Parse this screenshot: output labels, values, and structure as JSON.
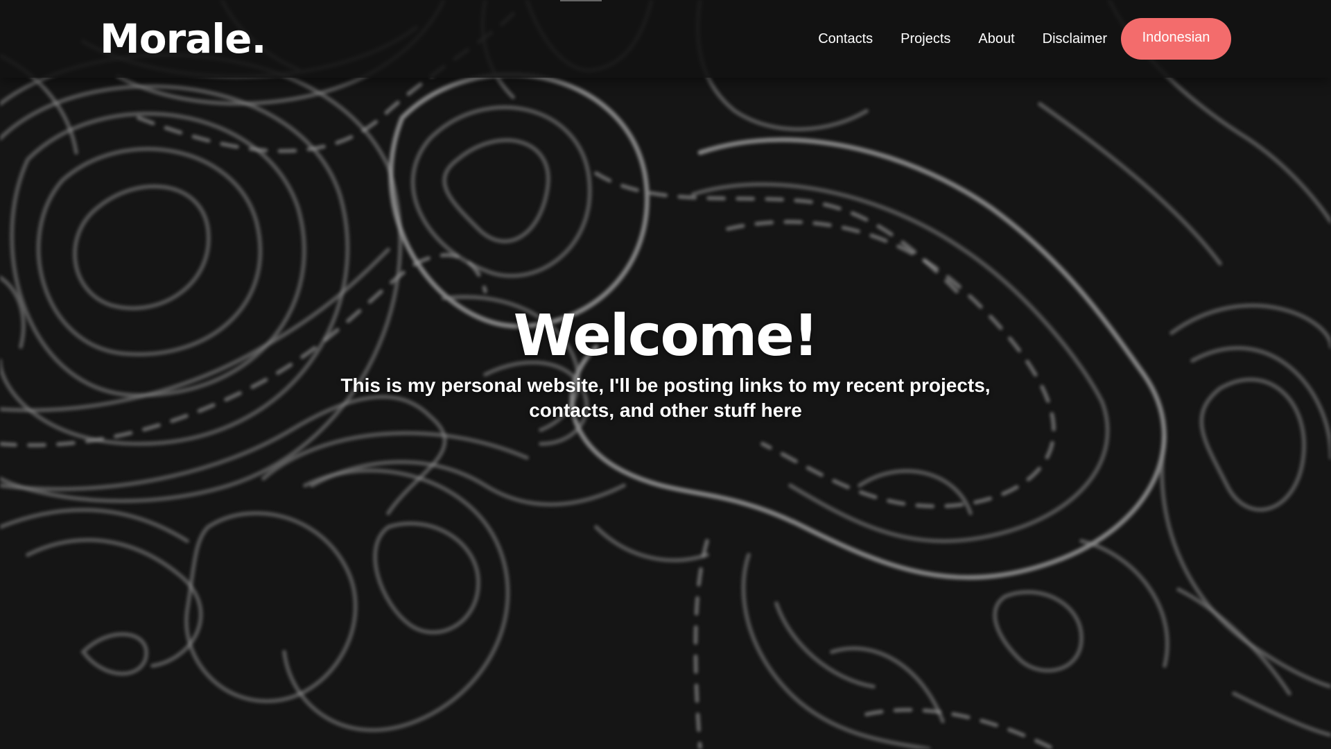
{
  "logo": {
    "text": "Morale."
  },
  "nav": {
    "links": [
      "Contacts",
      "Projects",
      "About",
      "Disclaimer"
    ],
    "language_button": "Indonesian"
  },
  "hero": {
    "title": "Welcome!",
    "subtitle": "This is my personal website, I'll be posting links to my recent projects, contacts, and other stuff here"
  },
  "colors": {
    "background": "#151515",
    "navbar": "#121212",
    "accent": "#f36c6c",
    "text": "#ffffff"
  }
}
